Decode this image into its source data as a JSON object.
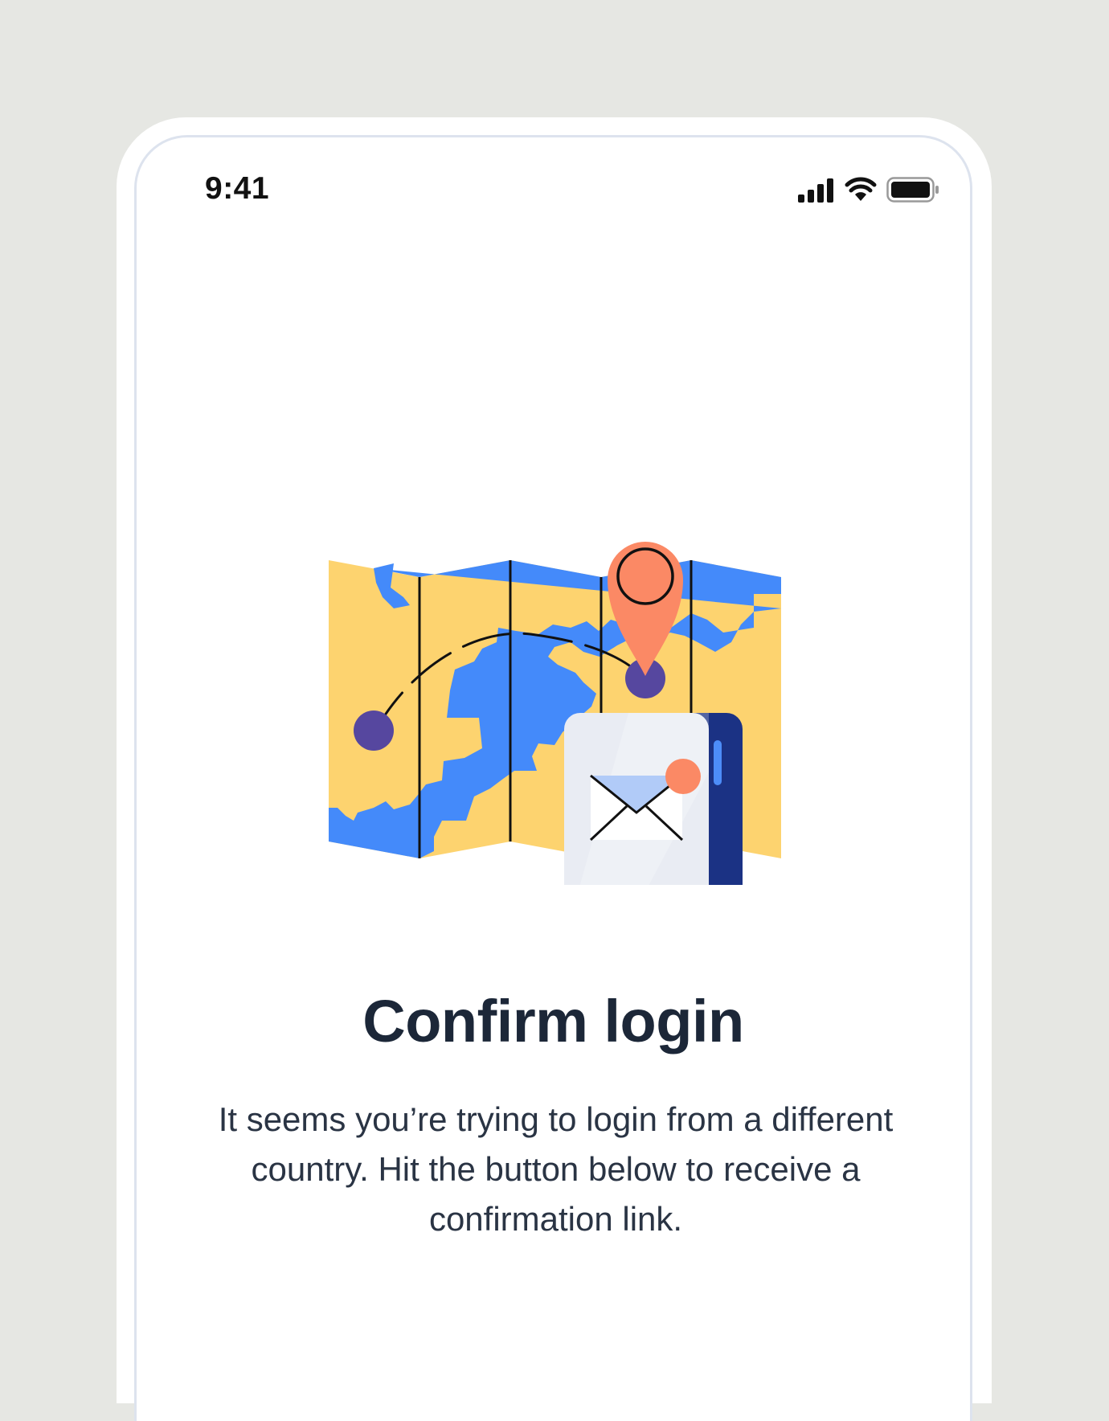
{
  "status_bar": {
    "time": "9:41",
    "signal_icon": "cellular-signal-icon",
    "wifi_icon": "wifi-icon",
    "battery_icon": "battery-icon"
  },
  "illustration": {
    "name": "map-with-location-pin-and-phone-email-illustration",
    "colors": {
      "map_land": "#fdd36f",
      "map_water": "#448afa",
      "pin": "#fb8965",
      "dot": "#56479f",
      "phone_body": "#e9ecf3",
      "phone_edge": "#1b3284",
      "phone_button": "#4d8df8"
    }
  },
  "content": {
    "title": "Confirm login",
    "description": "It seems you’re trying to login from a different country. Hit the button below to receive a confirmation link."
  }
}
